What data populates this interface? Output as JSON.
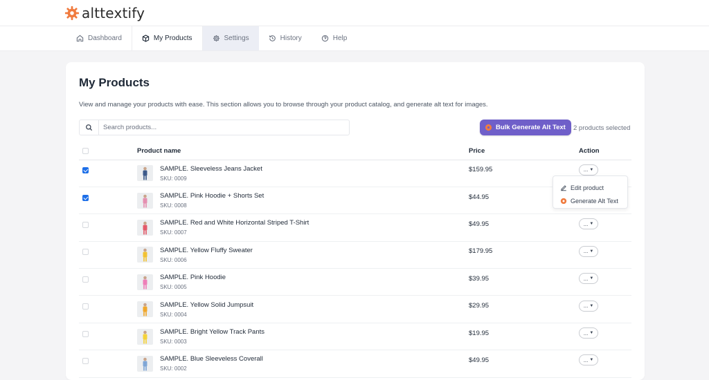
{
  "app": {
    "name": "alttextify"
  },
  "colors": {
    "accent": "#6f5fc9",
    "brand_orange": "#f07b3f",
    "check_blue": "#1d6fe8"
  },
  "nav": {
    "tabs": [
      {
        "label": "Dashboard",
        "icon": "home-icon"
      },
      {
        "label": "My Products",
        "icon": "box-icon",
        "active": true
      },
      {
        "label": "Settings",
        "icon": "gear-icon"
      },
      {
        "label": "History",
        "icon": "history-icon"
      },
      {
        "label": "Help",
        "icon": "help-circle-icon"
      }
    ]
  },
  "page": {
    "title": "My Products",
    "description": "View and manage your products with ease. This section allows you to browse through your product catalog, and generate alt text for images."
  },
  "search": {
    "placeholder": "Search products...",
    "value": ""
  },
  "bulk": {
    "button_label": "Bulk Generate Alt Text",
    "selected_text": "2 products selected"
  },
  "table": {
    "headers": {
      "name": "Product name",
      "price": "Price",
      "action": "Action"
    },
    "action_label": "...",
    "rows": [
      {
        "name": "SAMPLE. Sleeveless Jeans Jacket",
        "sku": "SKU: 0009",
        "price": "$159.95",
        "checked": true,
        "color": "#3d5a8a"
      },
      {
        "name": "SAMPLE. Pink Hoodie + Shorts Set",
        "sku": "SKU: 0008",
        "price": "$44.95",
        "checked": true,
        "color": "#e58fb0"
      },
      {
        "name": "SAMPLE. Red and White Horizontal Striped T-Shirt",
        "sku": "SKU: 0007",
        "price": "$49.95",
        "checked": false,
        "color": "#e35a6a"
      },
      {
        "name": "SAMPLE. Yellow Fluffy Sweater",
        "sku": "SKU: 0006",
        "price": "$179.95",
        "checked": false,
        "color": "#f2c232"
      },
      {
        "name": "SAMPLE. Pink Hoodie",
        "sku": "SKU: 0005",
        "price": "$39.95",
        "checked": false,
        "color": "#ee7fb8"
      },
      {
        "name": "SAMPLE. Yellow Solid Jumpsuit",
        "sku": "SKU: 0004",
        "price": "$29.95",
        "checked": false,
        "color": "#f0a72b"
      },
      {
        "name": "SAMPLE. Bright Yellow Track Pants",
        "sku": "SKU: 0003",
        "price": "$19.95",
        "checked": false,
        "color": "#f5d23a"
      },
      {
        "name": "SAMPLE. Blue Sleeveless Coverall",
        "sku": "SKU: 0002",
        "price": "$49.95",
        "checked": false,
        "color": "#7fa6d6"
      }
    ]
  },
  "dropdown": {
    "items": [
      {
        "label": "Edit product",
        "icon": "edit-icon"
      },
      {
        "label": "Generate Alt Text",
        "icon": "alttextify-gear-icon"
      }
    ]
  }
}
